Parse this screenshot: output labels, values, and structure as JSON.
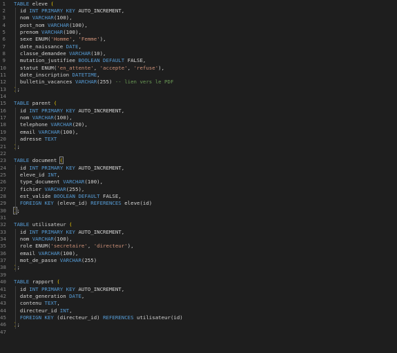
{
  "editor": {
    "lines": [
      {
        "n": "1",
        "tokens": [
          [
            "kw",
            "TABLE"
          ],
          [
            "id",
            " eleve "
          ],
          [
            "br",
            "("
          ]
        ]
      },
      {
        "n": "2",
        "tokens": [
          [
            "id",
            "  id "
          ],
          [
            "kw",
            "INT PRIMARY KEY"
          ],
          [
            "id",
            " AUTO_INCREMENT,"
          ]
        ]
      },
      {
        "n": "3",
        "tokens": [
          [
            "id",
            "  nom "
          ],
          [
            "kw",
            "VARCHAR"
          ],
          [
            "id",
            "(100),"
          ]
        ]
      },
      {
        "n": "4",
        "tokens": [
          [
            "id",
            "  post_nom "
          ],
          [
            "kw",
            "VARCHAR"
          ],
          [
            "id",
            "(100),"
          ]
        ]
      },
      {
        "n": "5",
        "tokens": [
          [
            "id",
            "  prenom "
          ],
          [
            "kw",
            "VARCHAR"
          ],
          [
            "id",
            "(100),"
          ]
        ]
      },
      {
        "n": "6",
        "tokens": [
          [
            "id",
            "  sexe ENUM("
          ],
          [
            "str",
            "'Homme'"
          ],
          [
            "id",
            ", "
          ],
          [
            "str",
            "'Femme'"
          ],
          [
            "id",
            "),"
          ]
        ]
      },
      {
        "n": "7",
        "tokens": [
          [
            "id",
            "  date_naissance "
          ],
          [
            "kw",
            "DATE"
          ],
          [
            "id",
            ","
          ]
        ]
      },
      {
        "n": "8",
        "tokens": [
          [
            "id",
            "  classe_demandee "
          ],
          [
            "kw",
            "VARCHAR"
          ],
          [
            "id",
            "(10),"
          ]
        ]
      },
      {
        "n": "9",
        "tokens": [
          [
            "id",
            "  mutation_justifiee "
          ],
          [
            "kw",
            "BOOLEAN DEFAULT"
          ],
          [
            "id",
            " FALSE,"
          ]
        ]
      },
      {
        "n": "10",
        "tokens": [
          [
            "id",
            "  statut ENUM("
          ],
          [
            "str",
            "'en_attente'"
          ],
          [
            "id",
            ", "
          ],
          [
            "str",
            "'accepte'"
          ],
          [
            "id",
            ", "
          ],
          [
            "str",
            "'refuse'"
          ],
          [
            "id",
            "),"
          ]
        ]
      },
      {
        "n": "11",
        "tokens": [
          [
            "id",
            "  date_inscription "
          ],
          [
            "kw",
            "DATETIME"
          ],
          [
            "id",
            ","
          ]
        ]
      },
      {
        "n": "12",
        "tokens": [
          [
            "id",
            "  bulletin_vacances "
          ],
          [
            "kw",
            "VARCHAR"
          ],
          [
            "id",
            "(255) "
          ],
          [
            "cm",
            "-- lien vers le PDF"
          ]
        ]
      },
      {
        "n": "13",
        "tokens": [
          [
            "br",
            ")"
          ],
          [
            "id",
            ";"
          ]
        ]
      },
      {
        "n": "14",
        "tokens": []
      },
      {
        "n": "15",
        "tokens": [
          [
            "kw",
            "TABLE"
          ],
          [
            "id",
            " parent "
          ],
          [
            "br",
            "("
          ]
        ]
      },
      {
        "n": "16",
        "tokens": [
          [
            "id",
            "  id "
          ],
          [
            "kw",
            "INT PRIMARY KEY"
          ],
          [
            "id",
            " AUTO_INCREMENT,"
          ]
        ]
      },
      {
        "n": "17",
        "tokens": [
          [
            "id",
            "  nom "
          ],
          [
            "kw",
            "VARCHAR"
          ],
          [
            "id",
            "(100),"
          ]
        ]
      },
      {
        "n": "18",
        "tokens": [
          [
            "id",
            "  telephone "
          ],
          [
            "kw",
            "VARCHAR"
          ],
          [
            "id",
            "(20),"
          ]
        ]
      },
      {
        "n": "19",
        "tokens": [
          [
            "id",
            "  email "
          ],
          [
            "kw",
            "VARCHAR"
          ],
          [
            "id",
            "(100),"
          ]
        ]
      },
      {
        "n": "20",
        "tokens": [
          [
            "id",
            "  adresse "
          ],
          [
            "kw",
            "TEXT"
          ]
        ]
      },
      {
        "n": "21",
        "tokens": [
          [
            "br",
            ")"
          ],
          [
            "id",
            ";"
          ]
        ]
      },
      {
        "n": "22",
        "tokens": []
      },
      {
        "n": "23",
        "tokens": [
          [
            "kw",
            "TABLE"
          ],
          [
            "id",
            " document "
          ],
          [
            "br",
            "("
          ]
        ]
      },
      {
        "n": "24",
        "tokens": [
          [
            "id",
            "  id "
          ],
          [
            "kw",
            "INT PRIMARY KEY"
          ],
          [
            "id",
            " AUTO_INCREMENT,"
          ]
        ]
      },
      {
        "n": "25",
        "tokens": [
          [
            "id",
            "  eleve_id "
          ],
          [
            "kw",
            "INT"
          ],
          [
            "id",
            ","
          ]
        ]
      },
      {
        "n": "26",
        "tokens": [
          [
            "id",
            "  type_document "
          ],
          [
            "kw",
            "VARCHAR"
          ],
          [
            "id",
            "(100),"
          ]
        ]
      },
      {
        "n": "27",
        "tokens": [
          [
            "id",
            "  fichier "
          ],
          [
            "kw",
            "VARCHAR"
          ],
          [
            "id",
            "(255),"
          ]
        ]
      },
      {
        "n": "28",
        "tokens": [
          [
            "id",
            "  est_valide "
          ],
          [
            "kw",
            "BOOLEAN DEFAULT"
          ],
          [
            "id",
            " FALSE,"
          ]
        ]
      },
      {
        "n": "29",
        "tokens": [
          [
            "id",
            "  "
          ],
          [
            "kw",
            "FOREIGN KEY"
          ],
          [
            "id",
            " (eleve_id) "
          ],
          [
            "kw",
            "REFERENCES"
          ],
          [
            "id",
            " eleve(id)"
          ]
        ]
      },
      {
        "n": "30",
        "tokens": [
          [
            "br",
            ")"
          ],
          [
            "id",
            ";"
          ]
        ]
      },
      {
        "n": "31",
        "tokens": []
      },
      {
        "n": "32",
        "tokens": [
          [
            "kw",
            "TABLE"
          ],
          [
            "id",
            " utilisateur "
          ],
          [
            "br",
            "("
          ]
        ]
      },
      {
        "n": "33",
        "tokens": [
          [
            "id",
            "  id "
          ],
          [
            "kw",
            "INT PRIMARY KEY"
          ],
          [
            "id",
            " AUTO_INCREMENT,"
          ]
        ]
      },
      {
        "n": "34",
        "tokens": [
          [
            "id",
            "  nom "
          ],
          [
            "kw",
            "VARCHAR"
          ],
          [
            "id",
            "(100),"
          ]
        ]
      },
      {
        "n": "35",
        "tokens": [
          [
            "id",
            "  role ENUM("
          ],
          [
            "str",
            "'secretaire'"
          ],
          [
            "id",
            ", "
          ],
          [
            "str",
            "'directeur'"
          ],
          [
            "id",
            "),"
          ]
        ]
      },
      {
        "n": "36",
        "tokens": [
          [
            "id",
            "  email "
          ],
          [
            "kw",
            "VARCHAR"
          ],
          [
            "id",
            "(100),"
          ]
        ]
      },
      {
        "n": "37",
        "tokens": [
          [
            "id",
            "  mot_de_passe "
          ],
          [
            "kw",
            "VARCHAR"
          ],
          [
            "id",
            "(255)"
          ]
        ]
      },
      {
        "n": "38",
        "tokens": [
          [
            "br",
            ")"
          ],
          [
            "id",
            ";"
          ]
        ]
      },
      {
        "n": "39",
        "tokens": []
      },
      {
        "n": "40",
        "tokens": [
          [
            "kw",
            "TABLE"
          ],
          [
            "id",
            " rapport "
          ],
          [
            "br",
            "("
          ]
        ]
      },
      {
        "n": "41",
        "tokens": [
          [
            "id",
            "  id "
          ],
          [
            "kw",
            "INT PRIMARY KEY"
          ],
          [
            "id",
            " AUTO_INCREMENT,"
          ]
        ]
      },
      {
        "n": "42",
        "tokens": [
          [
            "id",
            "  date_generation "
          ],
          [
            "kw",
            "DATE"
          ],
          [
            "id",
            ","
          ]
        ]
      },
      {
        "n": "43",
        "tokens": [
          [
            "id",
            "  contenu "
          ],
          [
            "kw",
            "TEXT"
          ],
          [
            "id",
            ","
          ]
        ]
      },
      {
        "n": "44",
        "tokens": [
          [
            "id",
            "  directeur_id "
          ],
          [
            "kw",
            "INT"
          ],
          [
            "id",
            ","
          ]
        ]
      },
      {
        "n": "45",
        "tokens": [
          [
            "id",
            "  "
          ],
          [
            "kw",
            "FOREIGN KEY"
          ],
          [
            "id",
            " (directeur_id) "
          ],
          [
            "kw",
            "REFERENCES"
          ],
          [
            "id",
            " utilisateur(id)"
          ]
        ]
      },
      {
        "n": "46",
        "tokens": [
          [
            "br",
            ")"
          ],
          [
            "id",
            ";"
          ]
        ]
      },
      {
        "n": "47",
        "tokens": []
      }
    ]
  },
  "colors": {
    "background": "#1e1e1e",
    "keyword": "#569cd6",
    "string": "#ce9178",
    "comment": "#6a9955",
    "text": "#d4d4d4",
    "line_number": "#858585",
    "bracket": "#ffd700"
  }
}
